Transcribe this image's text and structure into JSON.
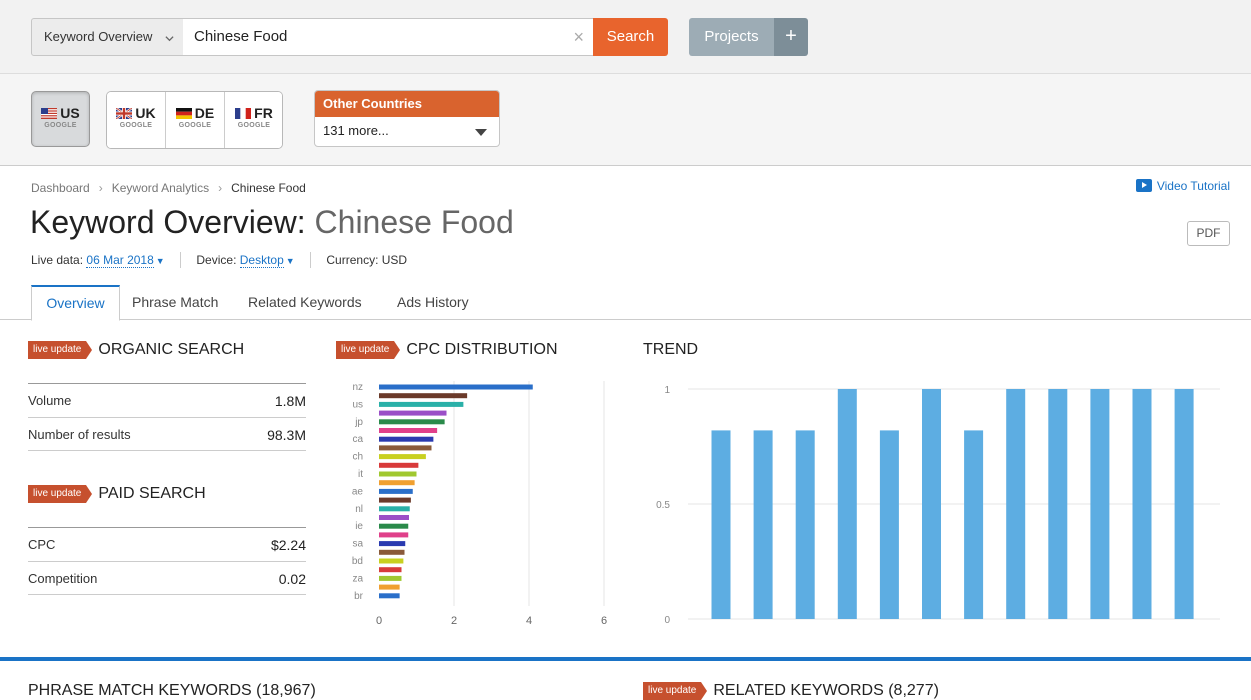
{
  "topbar": {
    "db_select": "Keyword Overview",
    "search_value": "Chinese Food",
    "search_button": "Search",
    "projects_button": "Projects",
    "projects_plus": "+"
  },
  "countries": {
    "selected": {
      "code": "US",
      "engine": "GOOGLE"
    },
    "group": [
      {
        "code": "UK",
        "engine": "GOOGLE"
      },
      {
        "code": "DE",
        "engine": "GOOGLE"
      },
      {
        "code": "FR",
        "engine": "GOOGLE"
      }
    ],
    "other_title": "Other Countries",
    "other_value": "131 more..."
  },
  "breadcrumb": [
    "Dashboard",
    "Keyword Analytics",
    "Chinese Food"
  ],
  "video_tutorial": "Video Tutorial",
  "header": {
    "title_prefix": "Keyword Overview:",
    "title_keyword": "Chinese Food",
    "pdf": "PDF",
    "live_label": "Live data:",
    "live_date": "06 Mar 2018",
    "device_label": "Device:",
    "device_value": "Desktop",
    "currency": "Currency: USD"
  },
  "tabs": [
    "Overview",
    "Phrase Match",
    "Related Keywords",
    "Ads History"
  ],
  "live_update": "live update",
  "organic": {
    "title": "ORGANIC SEARCH",
    "rows": [
      {
        "label": "Volume",
        "value": "1.8M"
      },
      {
        "label": "Number of results",
        "value": "98.3M"
      }
    ]
  },
  "paid": {
    "title": "PAID SEARCH",
    "rows": [
      {
        "label": "CPC",
        "value": "$2.24"
      },
      {
        "label": "Competition",
        "value": "0.02"
      }
    ]
  },
  "bottom": {
    "phrase_match": "PHRASE MATCH KEYWORDS (18,967)",
    "related": "RELATED KEYWORDS (8,277)"
  },
  "chart_data": [
    {
      "type": "bar",
      "orientation": "horizontal",
      "title": "CPC DISTRIBUTION",
      "categories": [
        "nz",
        "",
        "us",
        "",
        "jp",
        "",
        "ca",
        "",
        "ch",
        "",
        "it",
        "",
        "ae",
        "",
        "nl",
        "",
        "ie",
        "",
        "sa",
        "",
        "bd",
        "",
        "za",
        "",
        "br"
      ],
      "values": [
        4.1,
        2.35,
        2.25,
        1.8,
        1.75,
        1.55,
        1.45,
        1.4,
        1.25,
        1.05,
        1.0,
        0.95,
        0.9,
        0.85,
        0.82,
        0.8,
        0.78,
        0.78,
        0.7,
        0.68,
        0.65,
        0.6,
        0.6,
        0.55,
        0.55
      ],
      "colors": [
        "#2a6fc9",
        "#6b3a2a",
        "#2ab0a8",
        "#9b4fc7",
        "#2a8a4a",
        "#e0408a",
        "#2a3ab0",
        "#8a5a3a",
        "#c8d020",
        "#d83a3a",
        "#a0c830",
        "#f0a030",
        "#2a6fc9",
        "#6b3a2a",
        "#2ab0a8",
        "#9b4fc7",
        "#2a8a4a",
        "#e0408a",
        "#2a3ab0",
        "#8a5a3a",
        "#c8d020",
        "#d83a3a",
        "#a0c830",
        "#f0a030",
        "#2a6fc9"
      ],
      "x_ticks": [
        "0",
        "2",
        "4",
        "6"
      ],
      "xlim": [
        0,
        6
      ]
    },
    {
      "type": "bar",
      "title": "TREND",
      "values": [
        0.82,
        0.82,
        0.82,
        1,
        0.82,
        1,
        0.82,
        1,
        1,
        1,
        1,
        1
      ],
      "y_ticks": [
        "1",
        "0.5",
        "0"
      ],
      "ylim": [
        0,
        1
      ],
      "color": "#5dade2"
    }
  ]
}
